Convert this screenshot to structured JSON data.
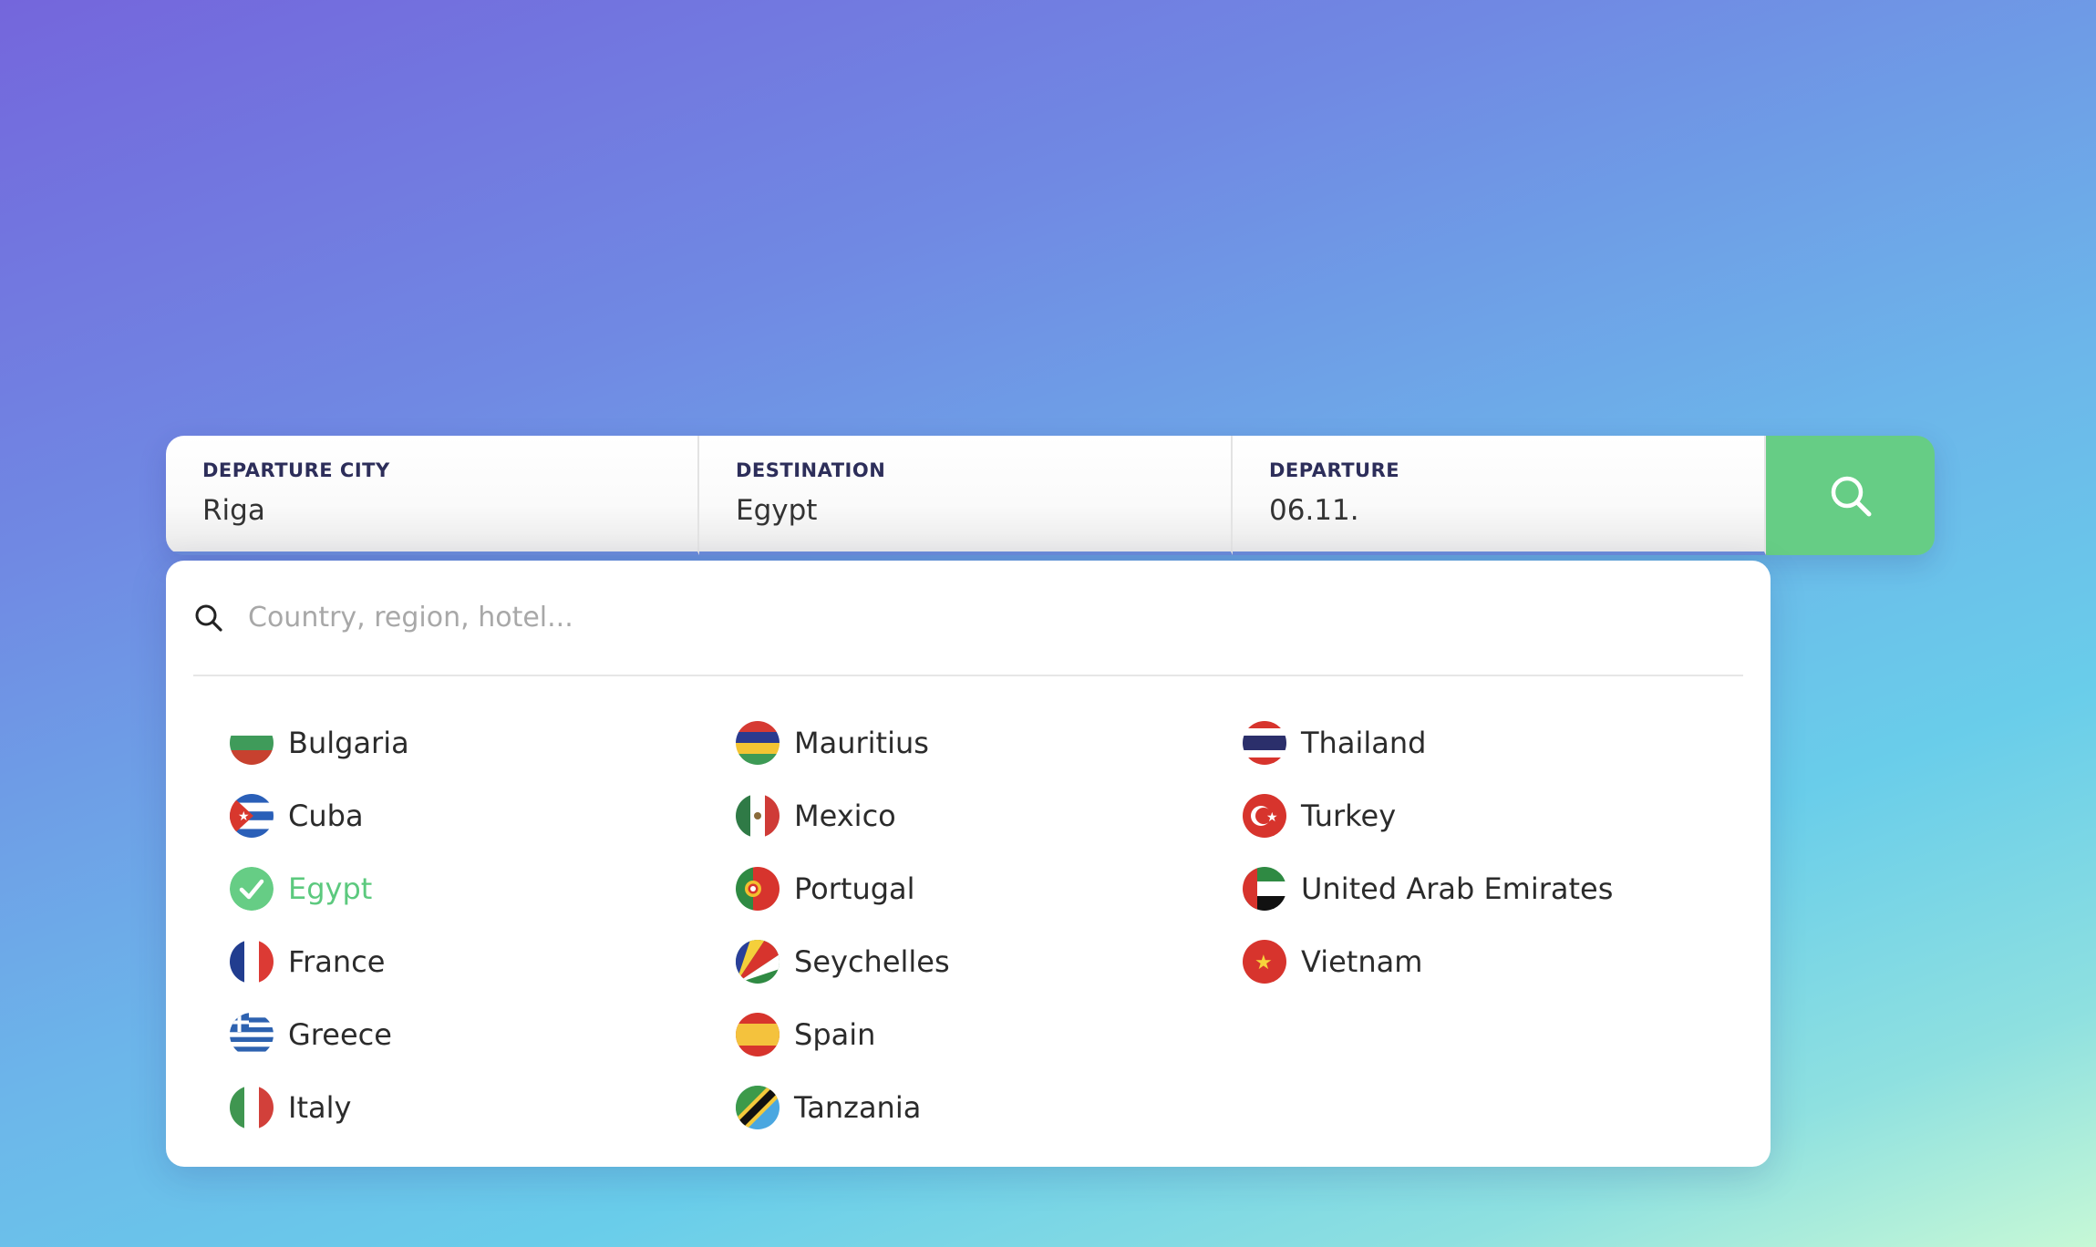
{
  "search": {
    "fields": [
      {
        "label": "DEPARTURE CITY",
        "value": "Riga"
      },
      {
        "label": "DESTINATION",
        "value": "Egypt"
      },
      {
        "label": "DEPARTURE",
        "value": "06.11."
      }
    ]
  },
  "dropdown": {
    "placeholder": "Country, region, hotel...",
    "selected": "Egypt",
    "countries": [
      [
        "Bulgaria",
        "Cuba",
        "Egypt",
        "France",
        "Greece",
        "Italy"
      ],
      [
        "Mauritius",
        "Mexico",
        "Portugal",
        "Seychelles",
        "Spain",
        "Tanzania"
      ],
      [
        "Thailand",
        "Turkey",
        "United Arab Emirates",
        "Vietnam"
      ]
    ]
  },
  "colors": {
    "accent": "#66cd85",
    "selected_text": "#5cc97e"
  }
}
